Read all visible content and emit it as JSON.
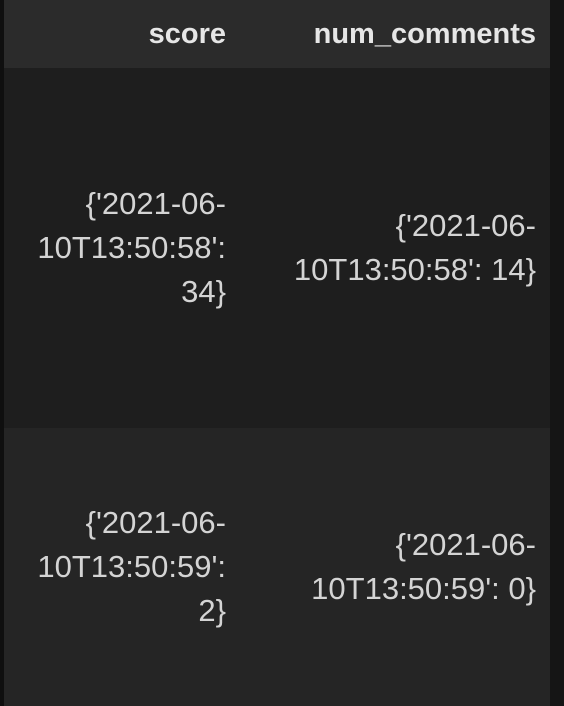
{
  "table": {
    "columns": [
      "score",
      "num_comments"
    ],
    "rows": [
      {
        "score_lines": [
          "{'2021-06-",
          "10T13:50:58':",
          "34}"
        ],
        "num_comments_lines": [
          "{'2021-06-",
          "10T13:50:58': 14}"
        ]
      },
      {
        "score_lines": [
          "{'2021-06-",
          "10T13:50:59':",
          "2}"
        ],
        "num_comments_lines": [
          "{'2021-06-",
          "10T13:50:59': 0}"
        ]
      }
    ]
  }
}
